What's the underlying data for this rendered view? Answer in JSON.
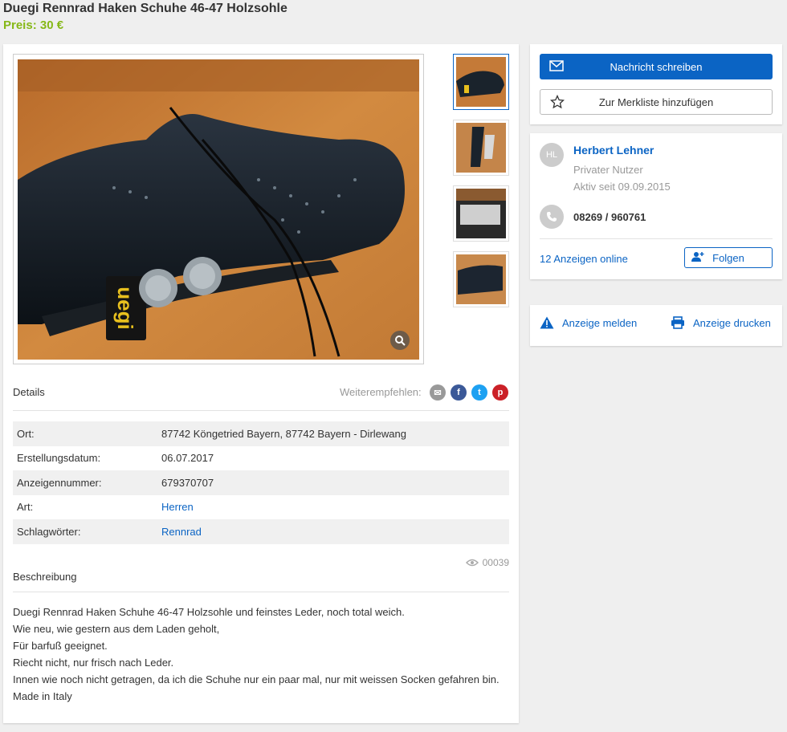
{
  "listing": {
    "title": "Duegi Rennrad Haken Schuhe 46-47 Holzsohle",
    "price": "Preis: 30 €"
  },
  "gallery": {
    "thumbnail_count": 4,
    "active_index": 0
  },
  "details": {
    "heading": "Details",
    "share_label": "Weiterempfehlen:",
    "rows": [
      {
        "key": "Ort:",
        "value": "87742 Köngetried Bayern, 87742 Bayern - Dirlewang"
      },
      {
        "key": "Erstellungsdatum:",
        "value": "06.07.2017"
      },
      {
        "key": "Anzeigennummer:",
        "value": "679370707"
      },
      {
        "key": "Art:",
        "value": "Herren"
      },
      {
        "key": "Schlagwörter:",
        "value": "Rennrad"
      }
    ]
  },
  "views": "00039",
  "description": {
    "heading": "Beschreibung",
    "lines": [
      "Duegi Rennrad Haken Schuhe 46-47 Holzsohle und feinstes Leder, noch total weich.",
      "Wie neu, wie gestern aus dem Laden geholt,",
      "Für barfuß geeignet.",
      "Riecht nicht, nur frisch nach Leder.",
      "Innen wie noch nicht getragen, da ich die Schuhe nur ein paar mal, nur mit weissen Socken gefahren bin.",
      "Made in Italy"
    ]
  },
  "actions": {
    "message_label": "Nachricht schreiben",
    "watchlist_label": "Zur Merkliste hinzufügen"
  },
  "seller": {
    "initials": "HL",
    "name": "Herbert Lehner",
    "type": "Privater Nutzer",
    "since": "Aktiv seit 09.09.2015",
    "phone": "08269 / 960761",
    "ads_online": "12 Anzeigen online",
    "follow_label": "Folgen"
  },
  "tools": {
    "report_label": "Anzeige melden",
    "print_label": "Anzeige drucken"
  },
  "colors": {
    "accent": "#0b64c4",
    "price": "#86b817",
    "background": "#efefef"
  }
}
